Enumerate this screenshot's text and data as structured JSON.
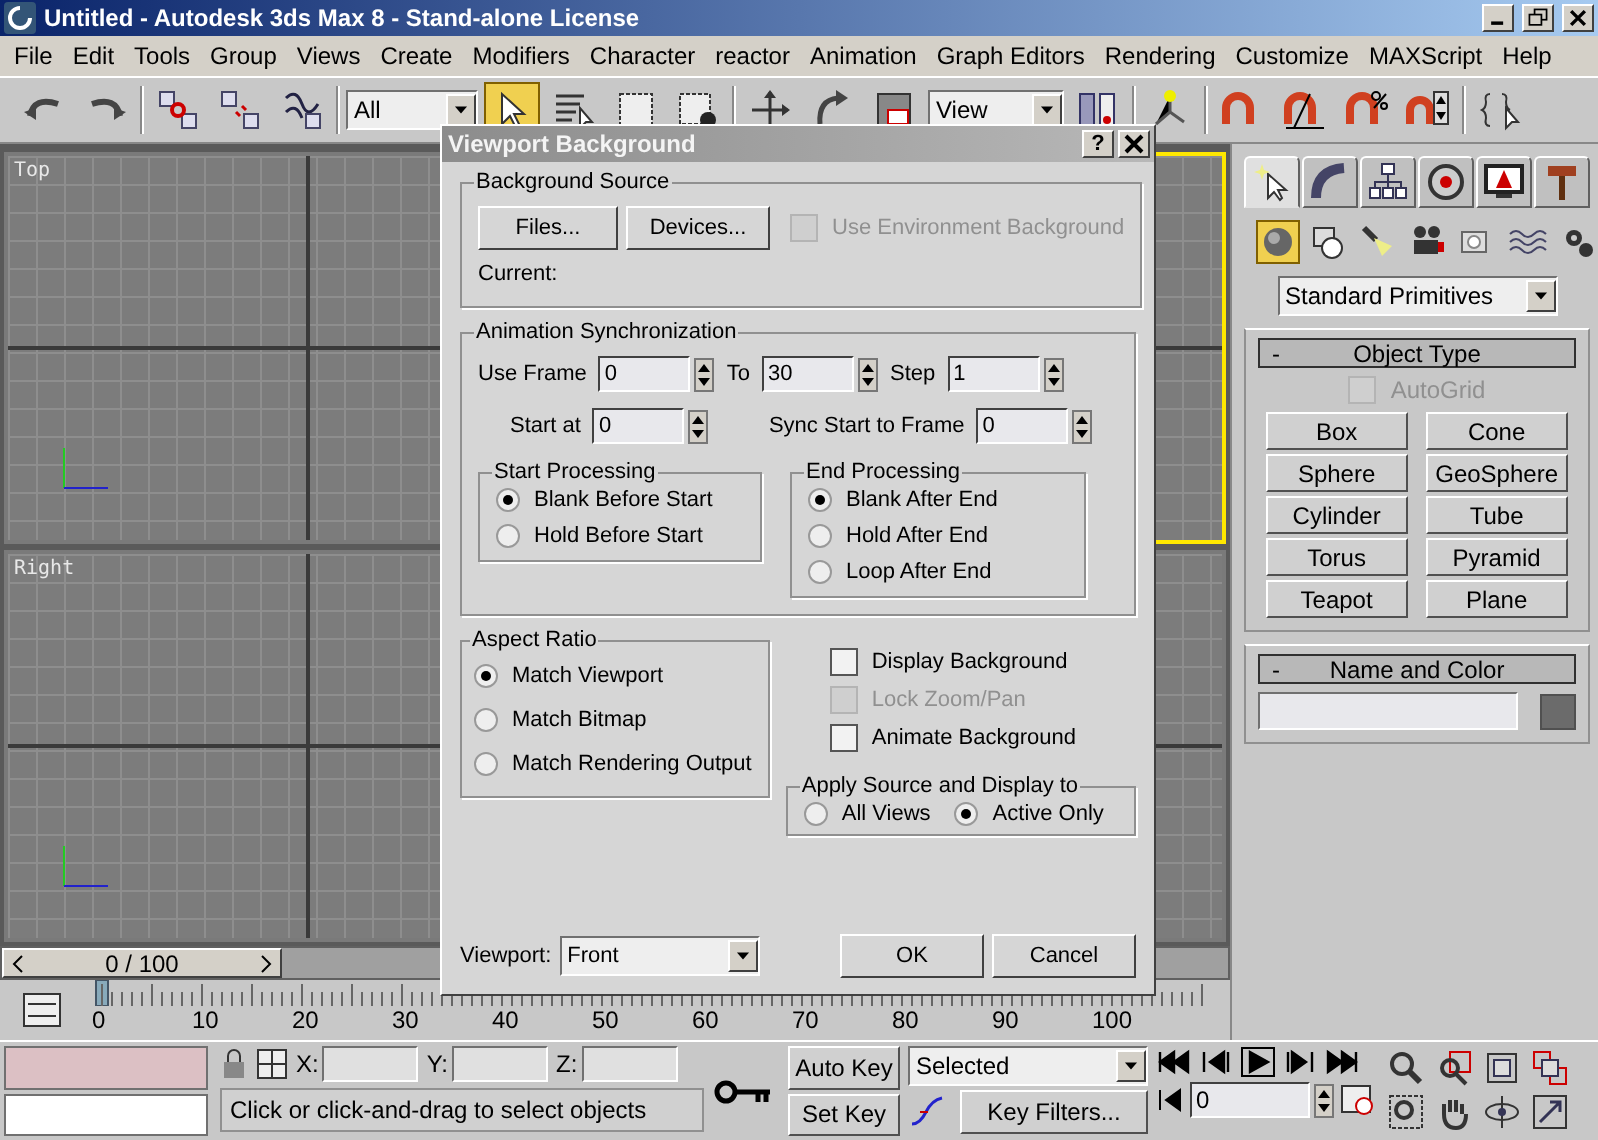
{
  "window": {
    "title": "Untitled - Autodesk 3ds Max 8  - Stand-alone License"
  },
  "menu": [
    "File",
    "Edit",
    "Tools",
    "Group",
    "Views",
    "Create",
    "Modifiers",
    "Character",
    "reactor",
    "Animation",
    "Graph Editors",
    "Rendering",
    "Customize",
    "MAXScript",
    "Help"
  ],
  "toolbar": {
    "items": [
      {
        "kind": "undo",
        "selected": false
      },
      {
        "kind": "redo",
        "selected": false
      },
      {
        "kind": "sep"
      },
      {
        "kind": "link",
        "selected": false
      },
      {
        "kind": "unlink",
        "selected": false
      },
      {
        "kind": "bind",
        "selected": false
      },
      {
        "kind": "sep"
      },
      {
        "kind": "filter",
        "value": "All"
      },
      {
        "kind": "select",
        "selected": true
      },
      {
        "kind": "select-name",
        "selected": false
      },
      {
        "kind": "region",
        "selected": false
      },
      {
        "kind": "window",
        "selected": false
      },
      {
        "kind": "sep"
      },
      {
        "kind": "move",
        "selected": false
      },
      {
        "kind": "rotate",
        "selected": false
      },
      {
        "kind": "scale",
        "selected": false
      },
      {
        "kind": "coord",
        "value": "View"
      },
      {
        "kind": "pivot",
        "selected": false
      },
      {
        "kind": "sep"
      },
      {
        "kind": "manip",
        "selected": false
      },
      {
        "kind": "sep"
      },
      {
        "kind": "snap",
        "selected": false
      },
      {
        "kind": "angle",
        "selected": false
      },
      {
        "kind": "percent",
        "selected": false
      },
      {
        "kind": "spinner",
        "selected": false
      },
      {
        "kind": "sep"
      },
      {
        "kind": "named",
        "selected": false
      }
    ]
  },
  "viewports": [
    {
      "label": "Top",
      "active": false
    },
    {
      "active": true
    },
    {
      "label": "Right",
      "active": false
    },
    {
      "active": false
    }
  ],
  "time_slider": {
    "label": "0 / 100"
  },
  "ruler_labels": [
    "0",
    "10",
    "20",
    "30",
    "40",
    "50",
    "60",
    "70",
    "80",
    "90",
    "100"
  ],
  "command_panel": {
    "tabs": [
      {
        "kind": "create",
        "selected": true
      },
      {
        "kind": "modify",
        "selected": false
      },
      {
        "kind": "hierarchy",
        "selected": false
      },
      {
        "kind": "motion",
        "selected": false
      },
      {
        "kind": "display",
        "selected": false
      },
      {
        "kind": "utilities",
        "selected": false
      }
    ],
    "categories": [
      {
        "kind": "geometry",
        "selected": true
      },
      {
        "kind": "shapes",
        "selected": false
      },
      {
        "kind": "lights",
        "selected": false
      },
      {
        "kind": "cameras",
        "selected": false
      },
      {
        "kind": "helpers",
        "selected": false
      },
      {
        "kind": "spacewarps",
        "selected": false
      },
      {
        "kind": "systems",
        "selected": false
      }
    ],
    "dropdown": "Standard Primitives",
    "object_type": {
      "sign": "-",
      "title": "Object Type",
      "autogrid": {
        "label": "AutoGrid",
        "checked": false,
        "disabled": true
      },
      "buttons": [
        "Box",
        "Cone",
        "Sphere",
        "GeoSphere",
        "Cylinder",
        "Tube",
        "Torus",
        "Pyramid",
        "Teapot",
        "Plane"
      ]
    },
    "name_color": {
      "sign": "-",
      "title": "Name and Color",
      "color": "#6b6b6b"
    }
  },
  "dialog": {
    "title": "Viewport Background",
    "help": "?",
    "background_source": {
      "title": "Background Source",
      "buttons": [
        "Files...",
        "Devices..."
      ],
      "use_environment": {
        "label": "Use Environment Background",
        "checked": false,
        "disabled": true
      },
      "current_label": "Current:"
    },
    "animation_sync": {
      "title": "Animation Synchronization",
      "use_frame": {
        "label": "Use Frame",
        "value": "0"
      },
      "to": {
        "label": "To",
        "value": "30"
      },
      "step": {
        "label": "Step",
        "value": "1"
      },
      "start_at": {
        "label": "Start at",
        "value": "0"
      },
      "sync_start": {
        "label": "Sync Start to Frame",
        "value": "0"
      },
      "start_processing": {
        "title": "Start Processing",
        "options": [
          {
            "label": "Blank Before Start",
            "selected": true
          },
          {
            "label": "Hold Before Start",
            "selected": false
          }
        ]
      },
      "end_processing": {
        "title": "End Processing",
        "options": [
          {
            "label": "Blank After End",
            "selected": true
          },
          {
            "label": "Hold After End",
            "selected": false
          },
          {
            "label": "Loop After End",
            "selected": false
          }
        ]
      }
    },
    "aspect_ratio": {
      "title": "Aspect Ratio",
      "options": [
        {
          "label": "Match Viewport",
          "selected": true
        },
        {
          "label": "Match Bitmap",
          "selected": false
        },
        {
          "label": "Match Rendering Output",
          "selected": false
        }
      ]
    },
    "checkboxes": [
      {
        "label": "Display Background",
        "checked": false,
        "disabled": false
      },
      {
        "label": "Lock Zoom/Pan",
        "checked": false,
        "disabled": true
      },
      {
        "label": "Animate Background",
        "checked": false,
        "disabled": false
      }
    ],
    "apply_to": {
      "title": "Apply Source and Display to",
      "options": [
        {
          "label": "All Views",
          "selected": false
        },
        {
          "label": "Active Only",
          "selected": true
        }
      ]
    },
    "viewport": {
      "label": "Viewport:",
      "value": "Front"
    },
    "buttons": [
      "OK",
      "Cancel"
    ]
  },
  "status": {
    "coords": [
      {
        "label": "X:"
      },
      {
        "label": "Y:"
      },
      {
        "label": "Z:"
      }
    ],
    "auto_key": "Auto Key",
    "set_key": "Set Key",
    "key_mode": "Selected",
    "key_filters": "Key Filters...",
    "frame": "0",
    "prompt": "Click or click-and-drag to select objects"
  }
}
